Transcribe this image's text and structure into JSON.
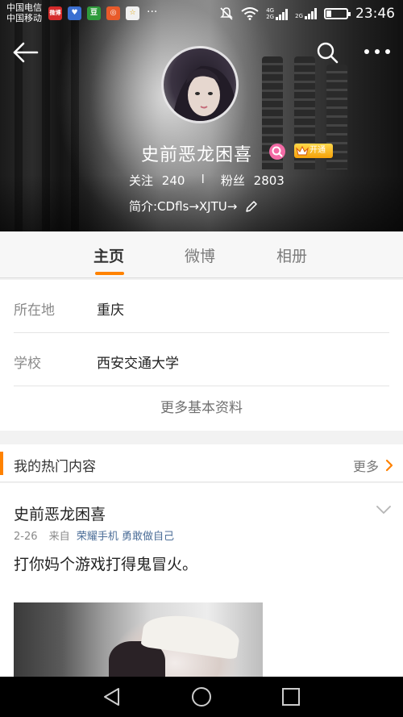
{
  "status_bar": {
    "carrier_1": "中国电信",
    "carrier_2": "中国移动",
    "app_icons": [
      {
        "name": "weibo-app-icon",
        "label": "微博",
        "color": "#d52b2b"
      },
      {
        "name": "heart-app-icon",
        "label": "♥",
        "color": "#3b6fd1"
      },
      {
        "name": "douban-app-icon",
        "label": "豆",
        "color": "#2f9b3c"
      },
      {
        "name": "recorder-app-icon",
        "label": "◎",
        "color": "#e85a2a"
      },
      {
        "name": "star-app-icon",
        "label": "☆",
        "color": "#f0f0f0"
      }
    ],
    "more_dots": "···",
    "net_4g": "4G",
    "net_2g_a": "2G",
    "net_2g_b": "2G",
    "time": "23:46"
  },
  "header": {
    "profile_name": "史前恶龙困喜",
    "vip_label": "开通",
    "following_label": "关注",
    "following_count": "240",
    "separator": "I",
    "followers_label": "粉丝",
    "followers_count": "2803",
    "bio": "简介:CDfls→XJTU→"
  },
  "tabs": [
    {
      "label": "主页",
      "active": true
    },
    {
      "label": "微博",
      "active": false
    },
    {
      "label": "相册",
      "active": false
    }
  ],
  "info": {
    "rows": [
      {
        "label": "所在地",
        "value": "重庆"
      },
      {
        "label": "学校",
        "value": "西安交通大学"
      }
    ],
    "more_label": "更多基本资料"
  },
  "hot": {
    "title": "我的热门内容",
    "more_label": "更多"
  },
  "post": {
    "author": "史前恶龙困喜",
    "date": "2-26",
    "from_label": "来自",
    "source": "荣耀手机 勇敢做自己",
    "text": "打你妈个游戏打得鬼冒火。"
  },
  "colors": {
    "accent": "#ff8200",
    "link": "#4c6e98",
    "vip_gold": "#f5a10a"
  }
}
